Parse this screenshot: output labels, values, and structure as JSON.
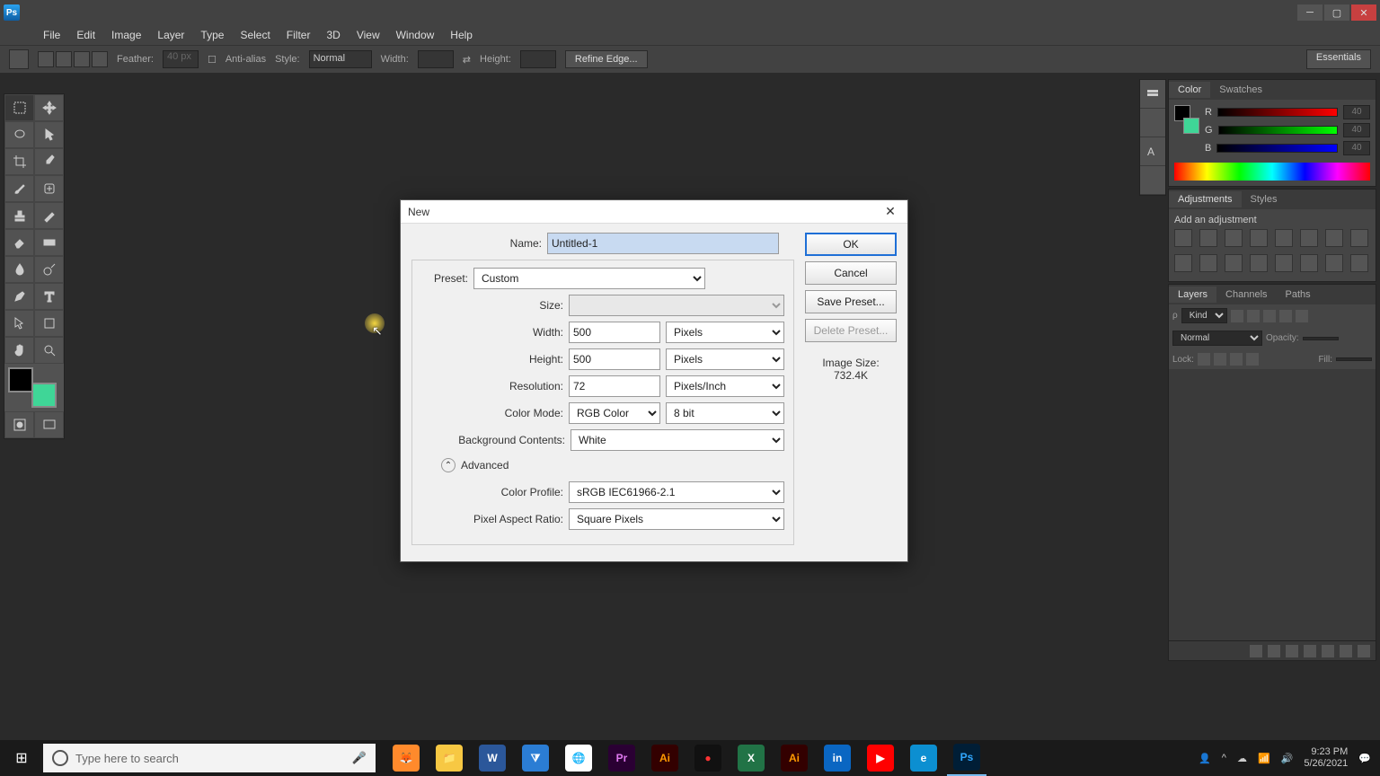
{
  "menus": [
    "File",
    "Edit",
    "Image",
    "Layer",
    "Type",
    "Select",
    "Filter",
    "3D",
    "View",
    "Window",
    "Help"
  ],
  "options": {
    "feather_label": "Feather:",
    "feather_value": "40 px",
    "antialias_label": "Anti-alias",
    "style_label": "Style:",
    "style_value": "Normal",
    "width_label": "Width:",
    "height_label": "Height:",
    "refine_label": "Refine Edge...",
    "workspace": "Essentials"
  },
  "dialog": {
    "title": "New",
    "name_label": "Name:",
    "name_value": "Untitled-1",
    "preset_label": "Preset:",
    "preset_value": "Custom",
    "size_label": "Size:",
    "size_value": "",
    "width_label": "Width:",
    "width_value": "500",
    "width_unit": "Pixels",
    "height_label": "Height:",
    "height_value": "500",
    "height_unit": "Pixels",
    "resolution_label": "Resolution:",
    "resolution_value": "72",
    "resolution_unit": "Pixels/Inch",
    "colormode_label": "Color Mode:",
    "colormode_value": "RGB Color",
    "colordepth_value": "8 bit",
    "bgcontents_label": "Background Contents:",
    "bgcontents_value": "White",
    "advanced_label": "Advanced",
    "colorprofile_label": "Color Profile:",
    "colorprofile_value": "sRGB IEC61966-2.1",
    "pixelaspect_label": "Pixel Aspect Ratio:",
    "pixelaspect_value": "Square Pixels",
    "ok": "OK",
    "cancel": "Cancel",
    "savepreset": "Save Preset...",
    "deletepreset": "Delete Preset...",
    "imagesize_label": "Image Size:",
    "imagesize_value": "732.4K"
  },
  "color": {
    "r_label": "R",
    "r_val": "40",
    "g_label": "G",
    "g_val": "40",
    "b_label": "B",
    "b_val": "40"
  },
  "panels": {
    "color_tab": "Color",
    "swatches_tab": "Swatches",
    "adjustments_tab": "Adjustments",
    "styles_tab": "Styles",
    "add_adjustment": "Add an adjustment",
    "layers_tab": "Layers",
    "channels_tab": "Channels",
    "paths_tab": "Paths",
    "kind_label": "Kind",
    "blend_normal": "Normal",
    "opacity_label": "Opacity:",
    "lock_label": "Lock:",
    "fill_label": "Fill:"
  },
  "taskbar": {
    "search_placeholder": "Type here to search",
    "time": "9:23 PM",
    "date": "5/26/2021"
  }
}
